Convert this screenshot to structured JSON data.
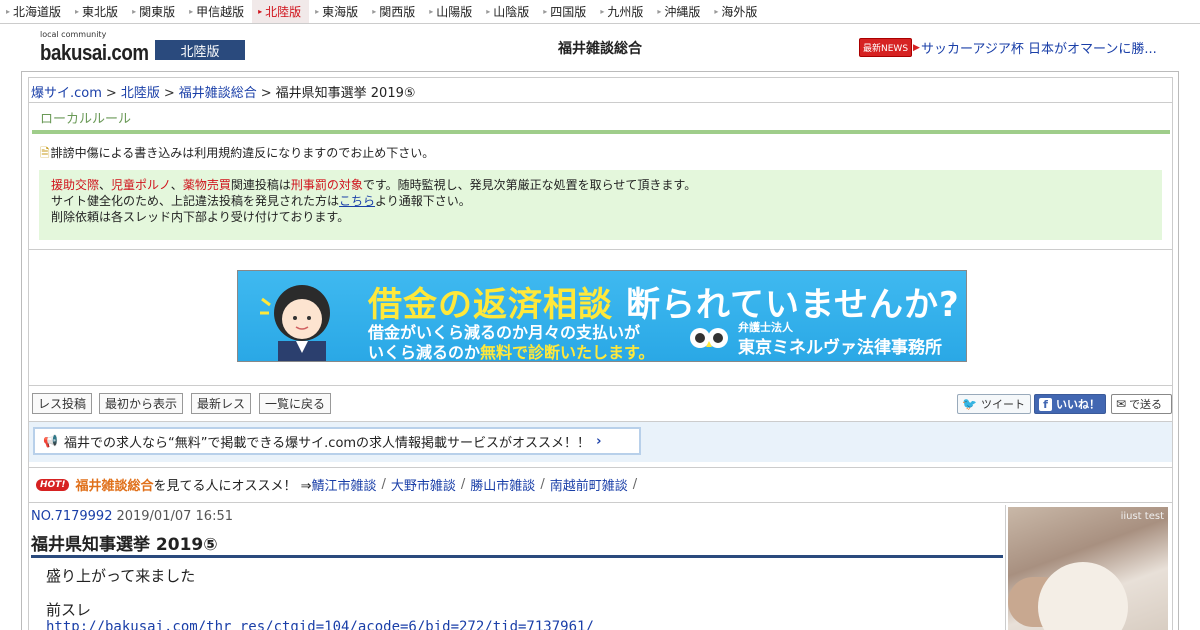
{
  "regions": [
    {
      "label": "北海道版",
      "active": false
    },
    {
      "label": "東北版",
      "active": false
    },
    {
      "label": "関東版",
      "active": false
    },
    {
      "label": "甲信越版",
      "active": false
    },
    {
      "label": "北陸版",
      "active": true
    },
    {
      "label": "東海版",
      "active": false
    },
    {
      "label": "関西版",
      "active": false
    },
    {
      "label": "山陽版",
      "active": false
    },
    {
      "label": "山陰版",
      "active": false
    },
    {
      "label": "四国版",
      "active": false
    },
    {
      "label": "九州版",
      "active": false
    },
    {
      "label": "沖縄版",
      "active": false
    },
    {
      "label": "海外版",
      "active": false
    }
  ],
  "header": {
    "logo_small": "local community",
    "logo_big": "bakusai.com",
    "region_badge": "北陸版",
    "title": "福井雑談総合",
    "news_badge": "最新NEWS",
    "news_text": "サッカーアジア杯 日本がオマーンに勝..."
  },
  "breadcrumb": {
    "home": "爆サイ.com",
    "region": "北陸版",
    "category": "福井雑談総合",
    "current": "福井県知事選挙 2019⑤"
  },
  "local_rule": {
    "title": "ローカルルール",
    "line1": "誹謗中傷による書き込みは利用規約違反になりますのでお止め下さい。",
    "warn_red1": "援助交際",
    "warn_red2": "児童ポルノ",
    "warn_red3": "薬物売買",
    "warn_mid": "関連投稿は",
    "warn_red4": "刑事罰の対象",
    "warn_tail": "です。随時監視し、発見次第厳正な処置を取らせて頂きます。",
    "warn_line2a": "サイト健全化のため、上記違法投稿を発見された方は",
    "warn_link": "こちら",
    "warn_line2b": "より通報下さい。",
    "warn_line3": "削除依頼は各スレッド内下部より受け付けております。"
  },
  "banner": {
    "head1": "借金の返済相談",
    "head2": "断られていませんか?",
    "sub1": "借金がいくら減るのか月々の支払いが",
    "sub2a": "いくら減るのか",
    "sub2b": "無料で診断いたします。",
    "firm_small": "弁護士法人",
    "firm": "東京ミネルヴァ法律事務所"
  },
  "toolbar": {
    "post_label": "レス投稿",
    "from_start_label": "最初から表示",
    "latest_label": "最新レス",
    "back_label": "一覧に戻る",
    "tweet_label": "ツイート",
    "like_label": "いいね！",
    "send_label": "で送る"
  },
  "job_banner": {
    "text": "福井での求人なら“無料”で掲載できる爆サイ.comの求人情報掲載サービスがオススメ！！"
  },
  "hot": {
    "badge": "HOT!",
    "category": "福井雑談総合",
    "lead": "を見てる人にオススメ！ ⇒ ",
    "links": [
      "鯖江市雑談",
      "大野市雑談",
      "勝山市雑談",
      "南越前町雑談"
    ]
  },
  "post": {
    "number": "NO.7179992",
    "date": "2019/01/07 16:51",
    "title": "福井県知事選挙 2019⑤",
    "body1": "盛り上がって来ました",
    "body2": "前スレ",
    "link": "http://bakusai.com/thr_res/ctgid=104/acode=6/bid=272/tid=7137961/"
  },
  "ad": {
    "credit": "iiust test"
  },
  "colors": {
    "accent_navy": "#2a4a7d",
    "link_blue": "#1a3fa8",
    "warn_red": "#d0121b",
    "rule_green": "#9fcd8a",
    "warn_bg": "#e4f7dc"
  }
}
